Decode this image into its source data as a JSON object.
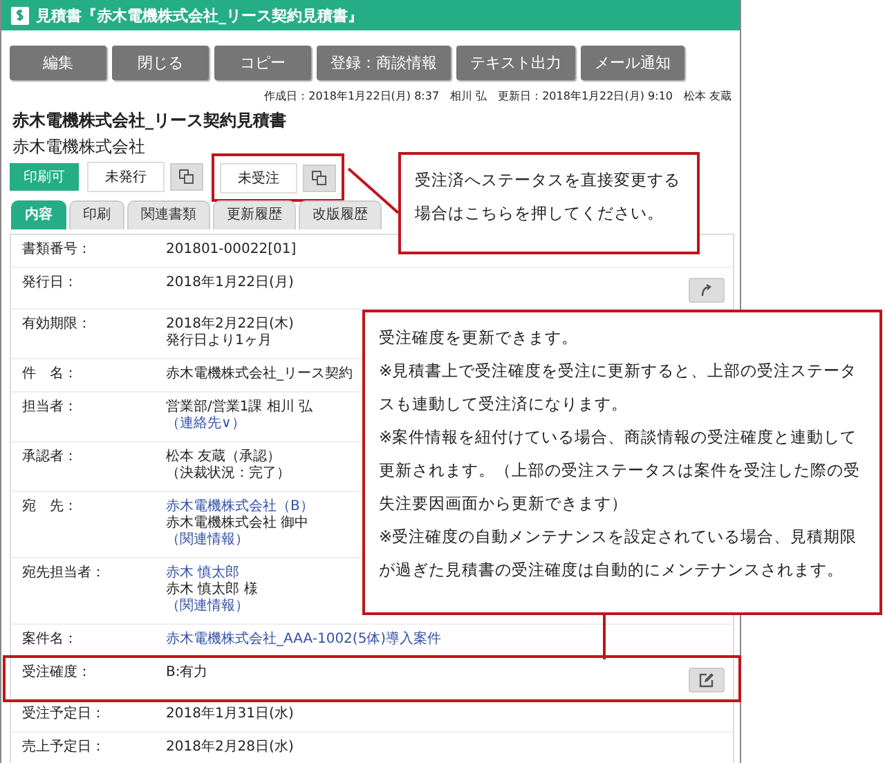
{
  "window": {
    "title": "見積書『赤木電機株式会社_リース契約見積書』"
  },
  "toolbar": [
    "編集",
    "閉じる",
    "コピー",
    "登録：商談情報",
    "テキスト出力",
    "メール通知"
  ],
  "meta": "作成日：2018年1月22日(月) 8:37　相川 弘　更新日：2018年1月22日(月) 9:10　松本 友蔵",
  "document": {
    "title": "赤木電機株式会社_リース契約見積書",
    "company": "赤木電機株式会社"
  },
  "statuses": [
    {
      "kind": "badge",
      "label": "印刷可",
      "highlighted": false
    },
    {
      "kind": "toggle",
      "label": "未発行",
      "highlighted": false
    },
    {
      "kind": "toggle",
      "label": "未受注",
      "highlighted": true
    }
  ],
  "tabs": [
    {
      "label": "内容",
      "selected": true
    },
    {
      "label": "印刷",
      "selected": false
    },
    {
      "label": "関連書類",
      "selected": false
    },
    {
      "label": "更新履歴",
      "selected": false
    },
    {
      "label": "改版履歴",
      "selected": false
    }
  ],
  "fields": [
    {
      "label": "書類番号：",
      "lines": [
        {
          "text": "201801-00022[01]",
          "link": false
        }
      ],
      "highlighted": false
    },
    {
      "label": "発行日：",
      "lines": [
        {
          "text": "2018年1月22日(月)",
          "link": false
        }
      ],
      "kind": "undo",
      "highlighted": false
    },
    {
      "label": "有効期限：",
      "lines": [
        {
          "text": "2018年2月22日(木)",
          "link": false
        },
        {
          "text": "発行日より1ヶ月",
          "link": false
        }
      ],
      "highlighted": false
    },
    {
      "label": "件　名：",
      "lines": [
        {
          "text": "赤木電機株式会社_リース契約",
          "link": false
        }
      ],
      "highlighted": false
    },
    {
      "label": "担当者：",
      "lines": [
        {
          "text": "営業部/営業1課 相川 弘",
          "link": false
        },
        {
          "text": "（連絡先∨）",
          "link": true
        }
      ],
      "highlighted": false
    },
    {
      "label": "承認者：",
      "lines": [
        {
          "text": "松本 友蔵（承認）",
          "link": false
        },
        {
          "text": "（決裁状況：完了）",
          "link": false
        }
      ],
      "highlighted": false
    },
    {
      "label": "宛　先：",
      "lines": [
        {
          "text": "赤木電機株式会社（B）",
          "link": true
        },
        {
          "text": "赤木電機株式会社 御中",
          "link": false
        },
        {
          "text": "（関連情報）",
          "link": true
        }
      ],
      "highlighted": false
    },
    {
      "label": "宛先担当者：",
      "lines": [
        {
          "text": "赤木 慎太郎",
          "link": true
        },
        {
          "text": "赤木 慎太郎 様",
          "link": false
        },
        {
          "text": "（関連情報）",
          "link": true
        }
      ],
      "highlighted": false
    },
    {
      "label": "案件名：",
      "lines": [
        {
          "text": "赤木電機株式会社_AAA-1002(5体)導入案件",
          "link": true
        }
      ],
      "highlighted": false
    },
    {
      "label": "受注確度：",
      "lines": [
        {
          "text": "B:有力",
          "link": false
        }
      ],
      "kind": "edit",
      "highlighted": true
    },
    {
      "label": "受注予定日：",
      "lines": [
        {
          "text": "2018年1月31日(水)",
          "link": false
        }
      ],
      "highlighted": false
    },
    {
      "label": "売上予定日：",
      "lines": [
        {
          "text": "2018年2月28日(水)",
          "link": false
        }
      ],
      "highlighted": false
    }
  ],
  "callouts": [
    {
      "kind": "status",
      "paragraphs": [
        "受注済へステータスを直接変更する場合はこちらを押してください。"
      ]
    },
    {
      "kind": "field",
      "paragraphs": [
        "受注確度を更新できます。",
        "※見積書上で受注確度を受注に更新すると、上部の受注ステータスも連動して受注済になります。",
        "※案件情報を紐付けている場合、商談情報の受注確度と連動して更新されます。（上部の受注ステータスは案件を受注した際の受失注要因画面から更新できます）",
        "※受注確度の自動メンテナンスを設定されている場合、見積期限が過ぎた見積書の受注確度は自動的にメンテナンスされます。"
      ]
    }
  ]
}
